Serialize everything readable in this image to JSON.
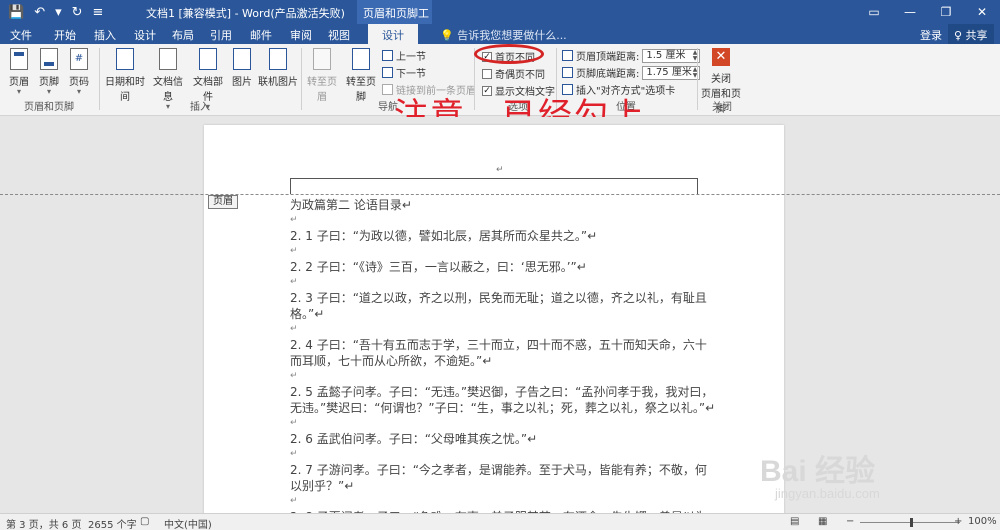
{
  "titlebar": {
    "qat": [
      "💾",
      "↶",
      "▾",
      "↻",
      "≡"
    ],
    "doc_title": "文档1 [兼容模式] - Word(产品激活失败)",
    "context_label": "页眉和页脚工具",
    "win_buttons": [
      "▭",
      "—",
      "❐",
      "✕"
    ]
  },
  "tabs": [
    "文件",
    "开始",
    "插入",
    "设计",
    "布局",
    "引用",
    "邮件",
    "审阅",
    "视图",
    "设计"
  ],
  "tellme": "💡 告诉我您想要做什么...",
  "login": "登录",
  "share": "♀ 共享",
  "ribbon": {
    "hf": {
      "header": "页眉",
      "footer": "页脚",
      "pagenum": "页码",
      "group": "页眉和页脚"
    },
    "insert": {
      "datetime": "日期和时间",
      "docinfo": "文档信息",
      "parts": "文档部件",
      "picture": "图片",
      "online_picture": "联机图片",
      "group": "插入"
    },
    "nav": {
      "goto_header": "转至页眉",
      "goto_footer": "转至页脚",
      "prev": "上一节",
      "next": "下一节",
      "link_prev": "链接到前一条页眉",
      "group": "导航"
    },
    "options": {
      "first_page": "首页不同",
      "odd_even": "奇偶页不同",
      "show_text": "显示文档文字",
      "group": "选项"
    },
    "position": {
      "top_label": "页眉顶端距离:",
      "top_value": "1.5 厘米",
      "bottom_label": "页脚底端距离:",
      "bottom_value": "1.75 厘米",
      "insert_align": "插入\"对齐方式\"选项卡",
      "group": "位置"
    },
    "close": {
      "label_1": "关闭",
      "label_2": "页眉和页脚",
      "group": "关闭"
    }
  },
  "annotation": "注意，已经勾上。",
  "document": {
    "header_tag": "页眉",
    "para_mark": "↵",
    "lines": [
      "为政篇第二  论语目录↵",
      "↵",
      "2. 1 子曰：“为政以德，譬如北辰，居其所而众星共之。”↵",
      "↵",
      "2. 2 子曰：“《诗》三百，一言以蔽之，曰：‘思无邪。’”↵",
      "↵",
      "2. 3 子曰：“道之以政，齐之以刑，民免而无耻；道之以德，齐之以礼，有耻且",
      "格。”↵",
      "↵",
      "2. 4 子曰：“吾十有五而志于学，三十而立，四十而不惑，五十而知天命，六十",
      "而耳顺，七十而从心所欲，不逾矩。”↵",
      "↵",
      "2. 5 孟懿子问孝。子曰：“无违。”樊迟御，子告之曰：“孟孙问孝于我，我对曰，",
      "无违。”樊迟曰：“何谓也？”子曰：“生，事之以礼；死，葬之以礼，祭之以礼。”↵",
      "↵",
      "2. 6 孟武伯问孝。子曰：“父母唯其疾之忧。”↵",
      "↵",
      "2. 7 子游问孝。子曰：“今之孝者，是谓能养。至于犬马，皆能有养；不敬，何",
      "以别乎？”↵",
      "↵",
      "2. 8 子夏问孝。子曰：“色难。有事，弟子服其劳；有酒食，先生馔，曾是以为"
    ]
  },
  "watermark": {
    "brand": "Bai 经验",
    "url": "jingyan.baidu.com"
  },
  "status": {
    "page": "第 3 页，共 6 页",
    "words": "2655 个字",
    "lang": "中文(中国)",
    "zoom": "100%"
  }
}
